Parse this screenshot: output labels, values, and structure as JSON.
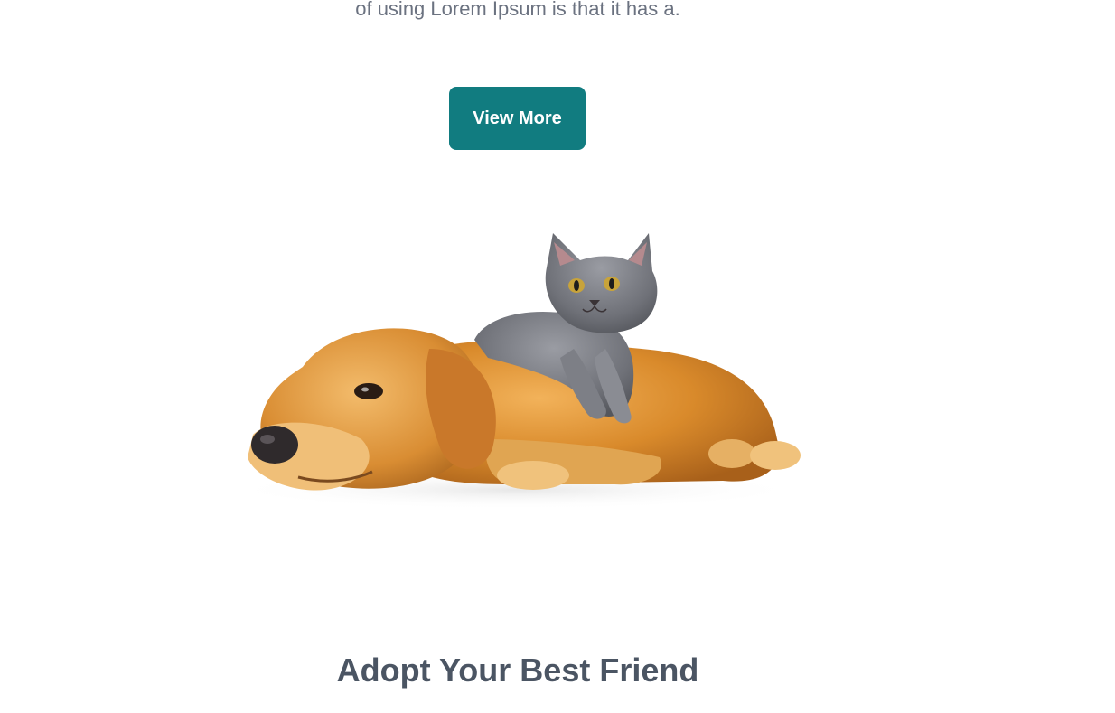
{
  "hero": {
    "intro_text": "of using Lorem Ipsum is that it has a.",
    "view_more_label": "View More"
  },
  "image": {
    "alt": "Golden retriever lying down with a grey kitten on its back"
  },
  "adopt_section": {
    "title": "Adopt Your Best Friend"
  },
  "colors": {
    "button_bg": "#117c80",
    "button_text": "#ffffff",
    "body_text": "#6b7280",
    "heading_text": "#4b5563"
  }
}
